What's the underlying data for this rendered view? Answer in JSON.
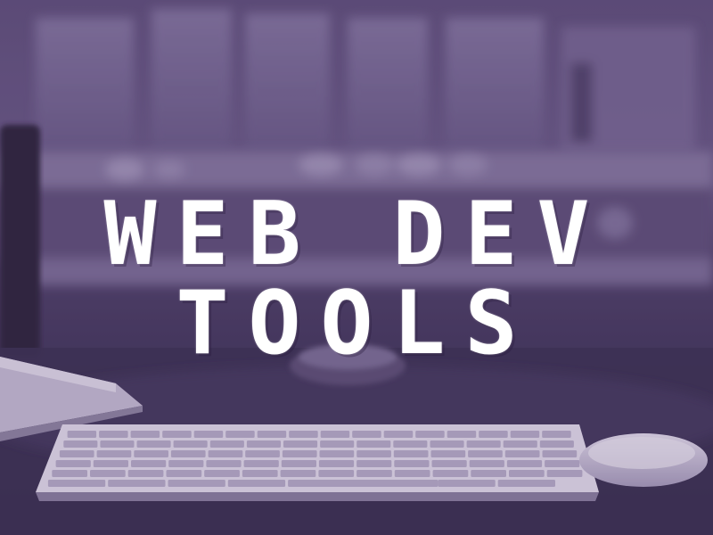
{
  "image": {
    "tint_color": "#5a4a78",
    "title_color": "#ffffff"
  },
  "title": {
    "line1": "WEB DEV",
    "line2": "TOOLS"
  }
}
